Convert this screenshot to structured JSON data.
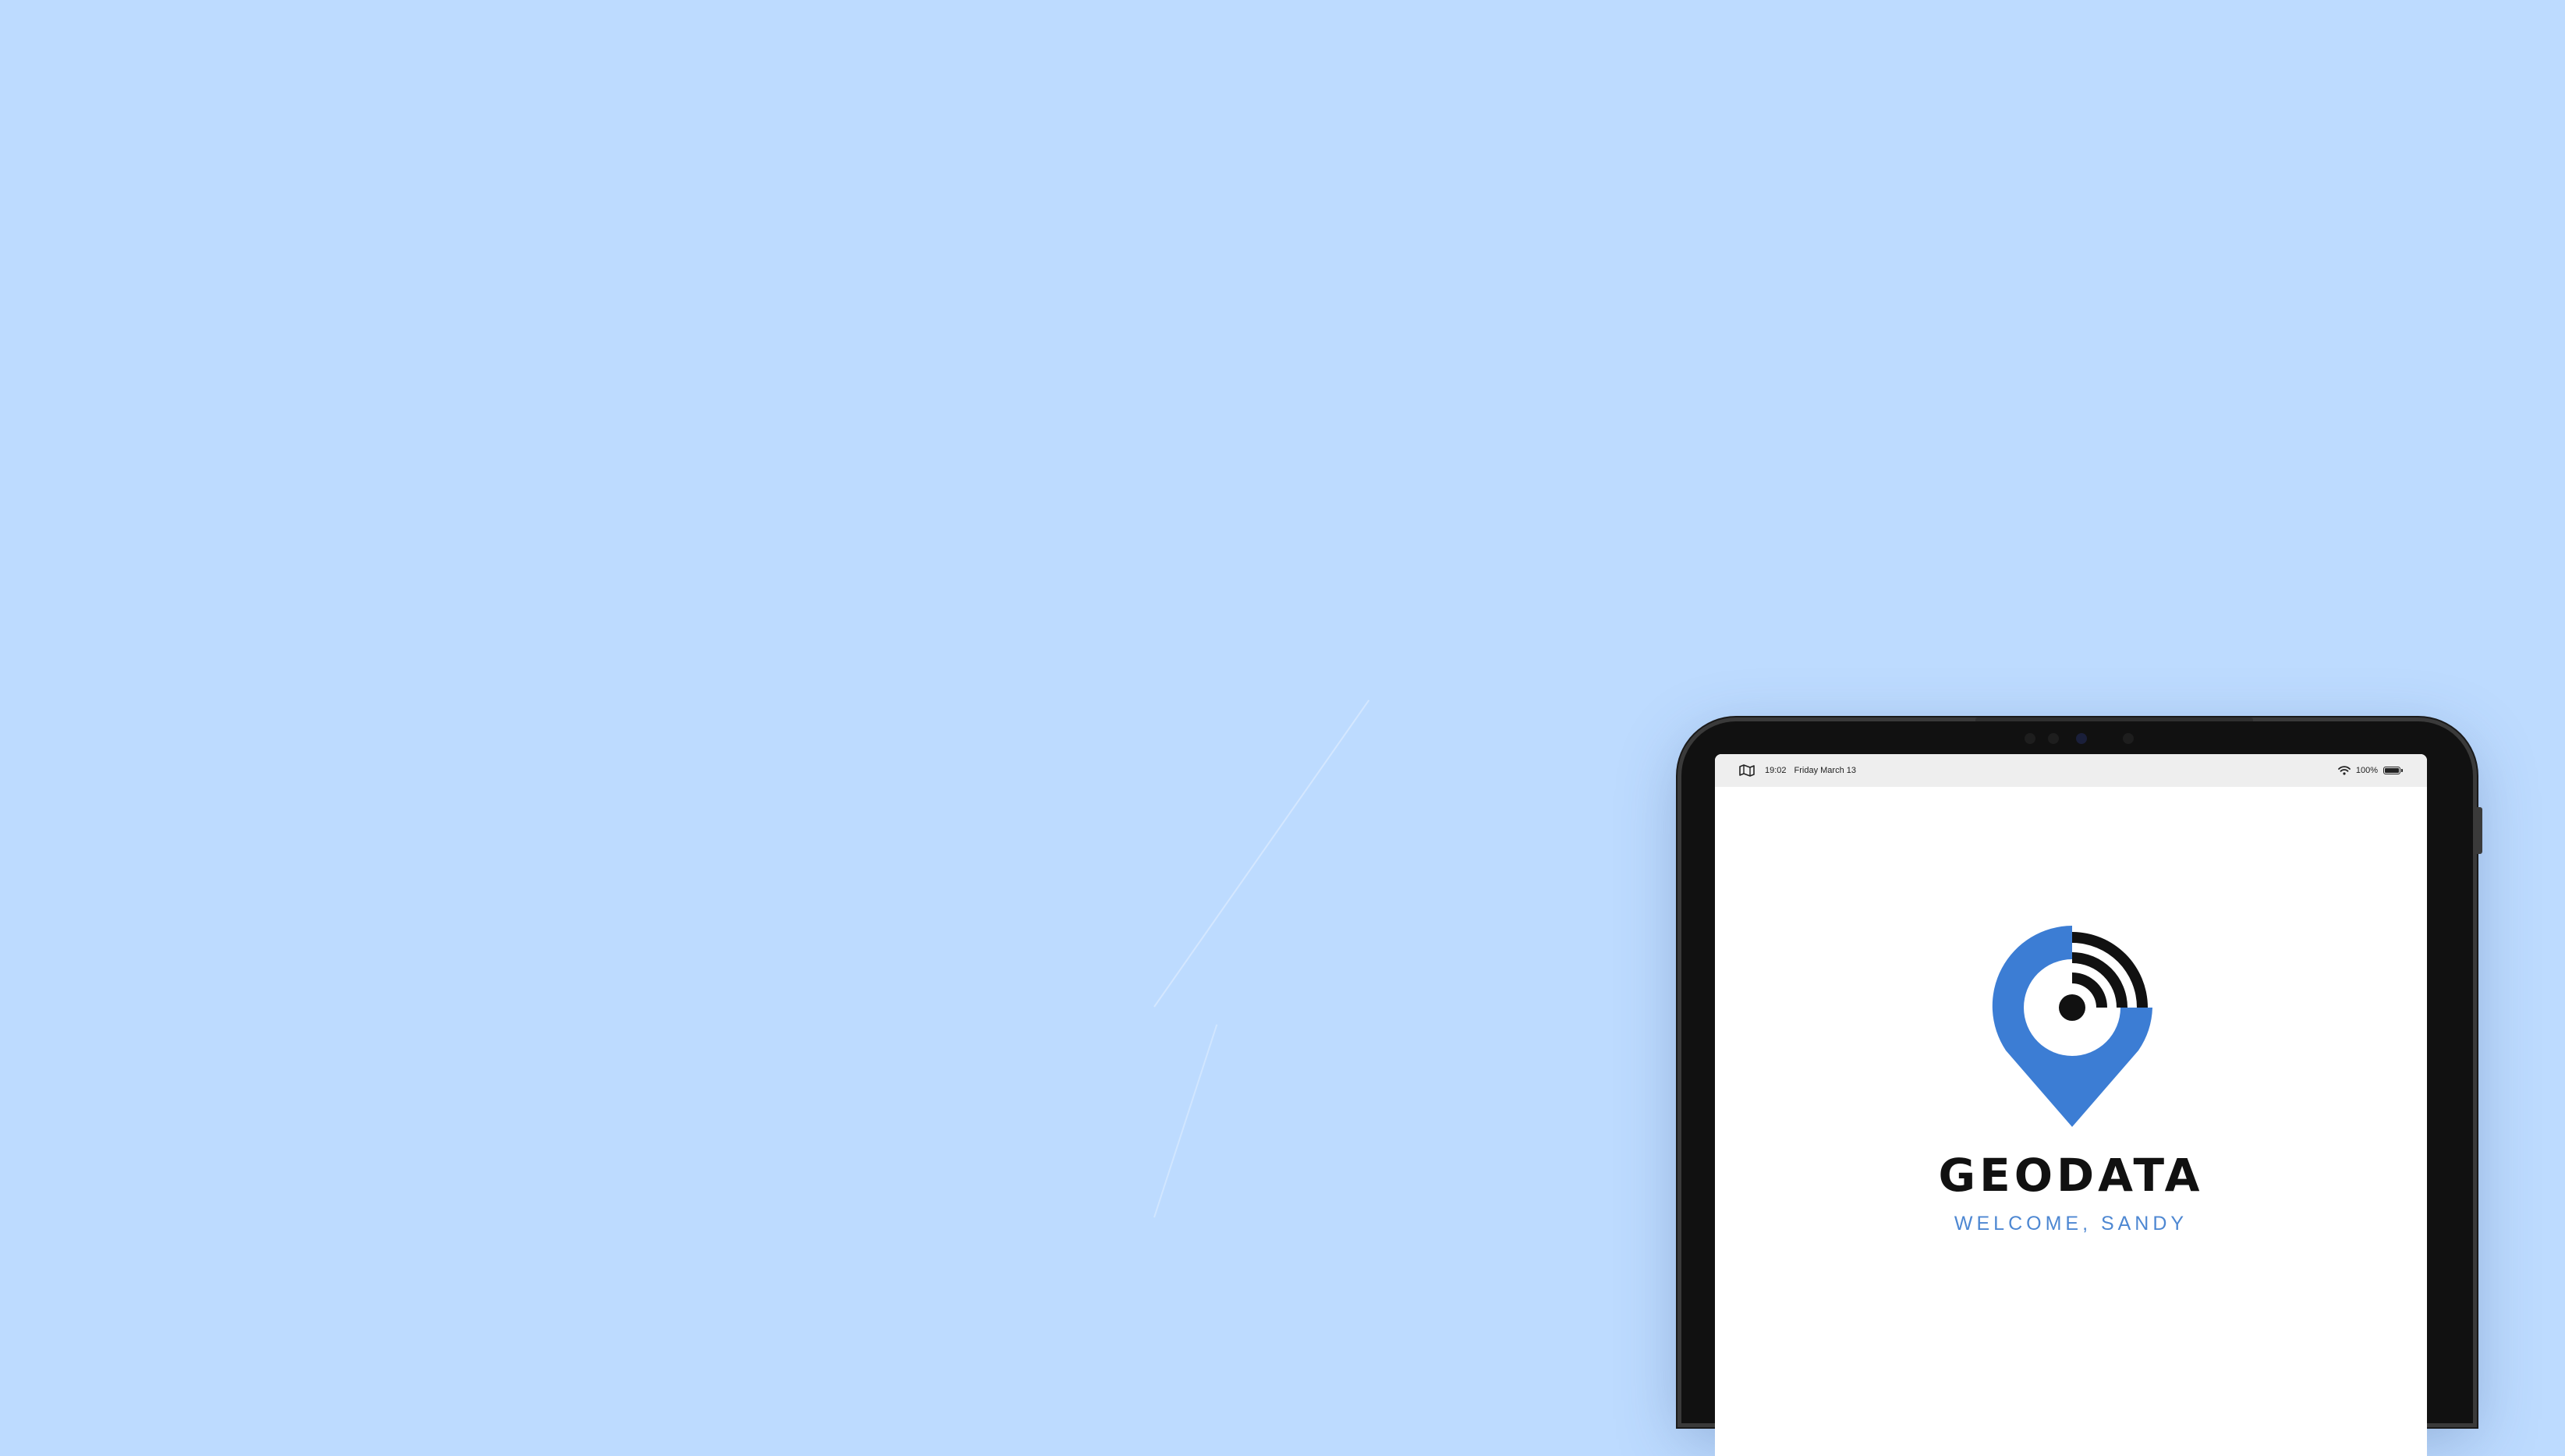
{
  "status_bar": {
    "icon": "map-icon",
    "time": "19:02",
    "date": "Friday March 13",
    "wifi_icon": "wifi-icon",
    "battery_text": "100%",
    "battery_level": 1.0
  },
  "app": {
    "name": "GEODATA",
    "welcome": "WELCOME, SANDY",
    "logo_icon": "location-pin-signal-icon"
  },
  "colors": {
    "background": "#bddbff",
    "accent": "#3c7dd4",
    "welcome_text": "#4d87d2",
    "logo_dark": "#111111"
  }
}
